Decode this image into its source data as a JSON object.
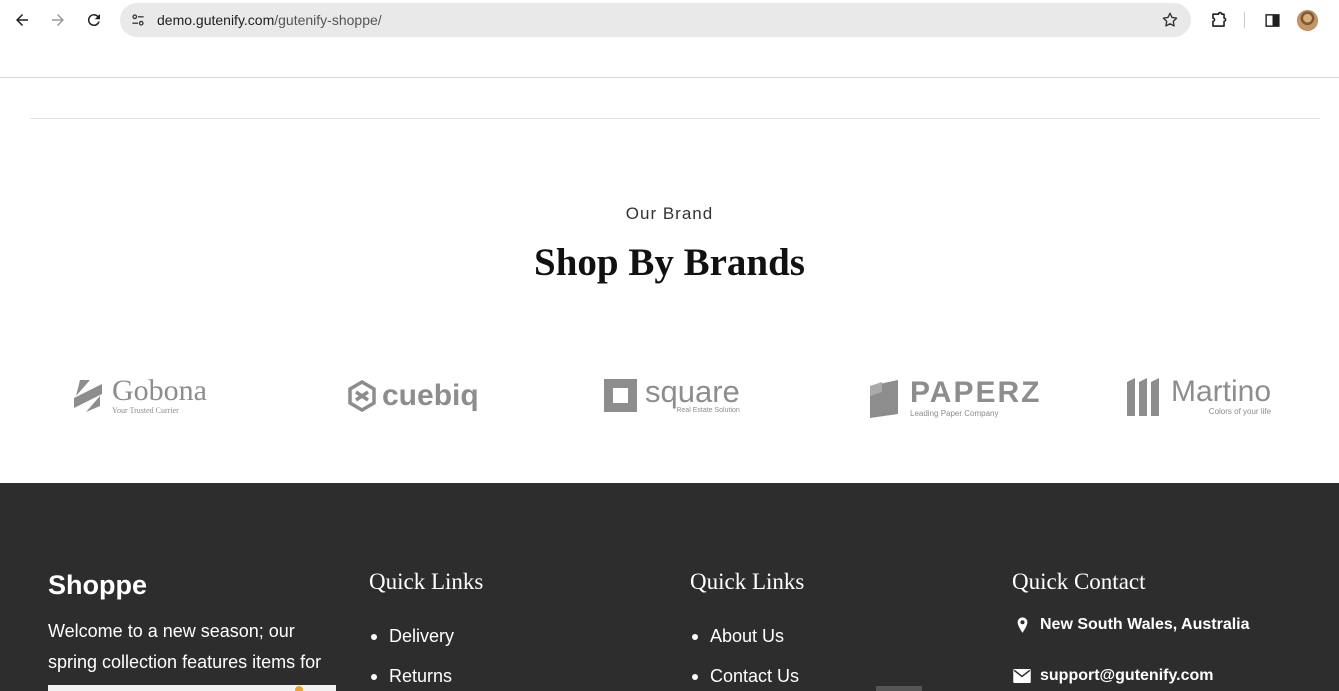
{
  "browser": {
    "url_host": "demo.gutenify.com",
    "url_path": "/gutenify-shoppe/"
  },
  "brands": {
    "eyebrow": "Our Brand",
    "title": "Shop By Brands",
    "logos": [
      {
        "name": "Gobona",
        "tagline": "Your Trusted Currier"
      },
      {
        "name": "cuebiq",
        "tagline": ""
      },
      {
        "name": "square",
        "tagline": "Real Estate Solution"
      },
      {
        "name": "PAPERZ",
        "tagline": "Leading Paper Company"
      },
      {
        "name": "Martino",
        "tagline": "Colors of your life"
      }
    ]
  },
  "footer": {
    "brand": "Shoppe",
    "description": "Welcome to a new season; our spring collection features items for",
    "col1": {
      "heading": "Quick Links",
      "links": [
        "Delivery",
        "Returns"
      ]
    },
    "col2": {
      "heading": "Quick Links",
      "links": [
        "About Us",
        "Contact Us"
      ]
    },
    "contact": {
      "heading": "Quick Contact",
      "address": "New South Wales, Australia",
      "email": "support@gutenify.com"
    }
  }
}
